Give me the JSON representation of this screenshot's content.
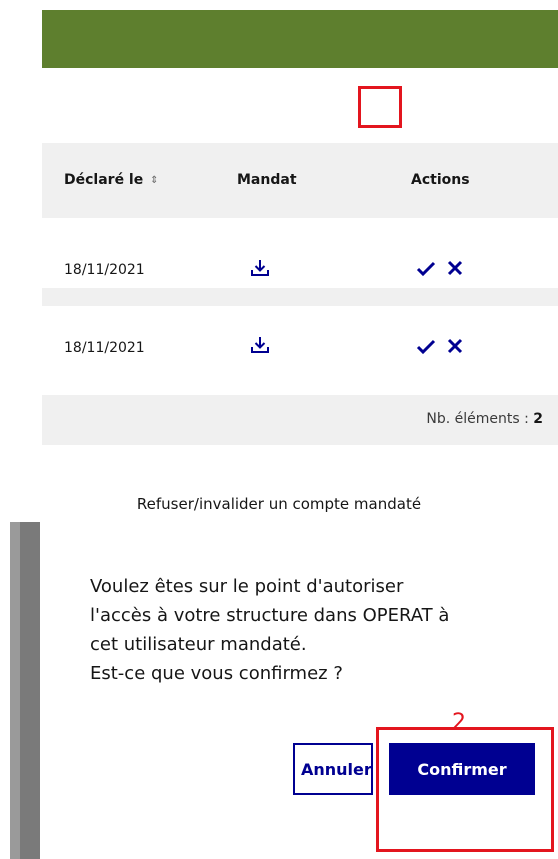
{
  "table": {
    "headers": {
      "declared": "Déclaré le",
      "sort_icon": "⌃⌄",
      "mandate": "Mandat",
      "actions": "Actions"
    },
    "rows": [
      {
        "date": "18/11/2021"
      },
      {
        "date": "18/11/2021"
      }
    ],
    "count_label": "Nb. éléments : ",
    "count_value": "2"
  },
  "caption": "Refuser/invalider un compte mandaté",
  "modal": {
    "lines": [
      "Voulez êtes sur le point d'autoriser",
      "l'accès à votre structure dans OPERAT à",
      "cet utilisateur mandaté.",
      "Est-ce que vous confirmez ?"
    ],
    "cancel_label": "Annuler",
    "confirm_label": "Confirmer"
  },
  "annotations": {
    "step_number": "2"
  },
  "colors": {
    "header_green": "#5e7f2e",
    "primary_blue": "#000091",
    "highlight_red": "#e3151e",
    "row_gray": "#f0f0f0"
  },
  "icons": {
    "download": "download-icon",
    "validate": "check-icon",
    "refuse": "close-icon"
  }
}
